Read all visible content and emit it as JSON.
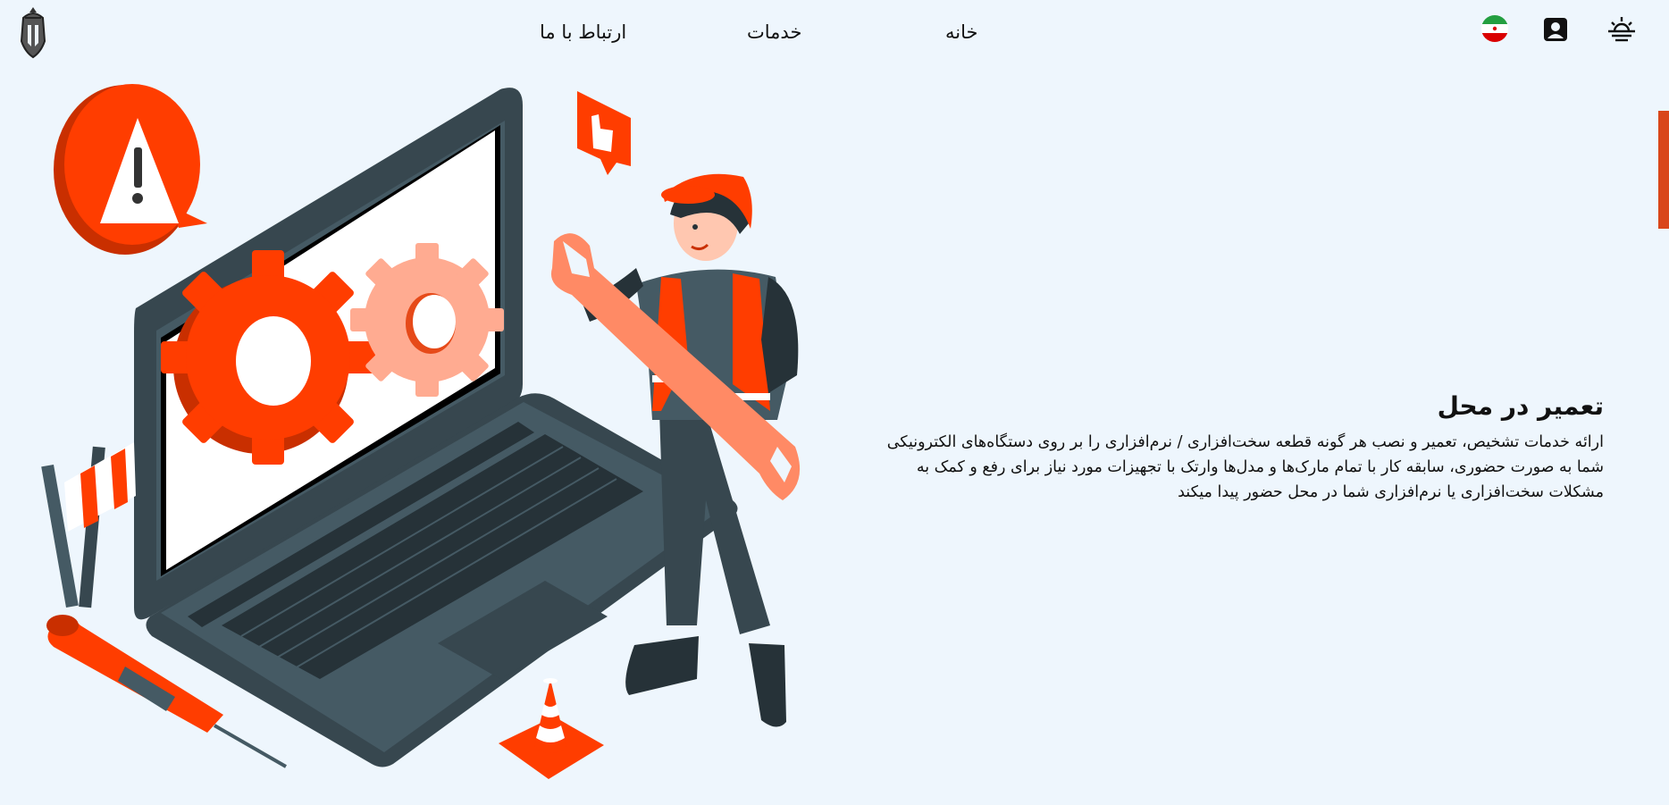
{
  "nav": {
    "contact_label": "ارتباط با ما",
    "services_label": "خدمات",
    "home_label": "خانه"
  },
  "icons": {
    "logo": "spartan-helmet-logo",
    "language": "iran-flag-icon",
    "profile": "user-profile-icon",
    "theme": "sunset-icon"
  },
  "hero": {
    "title": "تعمیر در محل",
    "description": "ارائه خدمات تشخیص، تعمیر و نصب هر گونه قطعه سخت‌افزاری / نرم‌افزاری را بر روی دستگاه‌های الکترونیکی شما به صورت حضوری، سابقه کار با تمام مارک‌ها و مدل‌ها وارتک با تجهیزات مورد نیاز برای رفع و کمک به مشکلات سخت‌افزاری یا نرم‌افزاری شما در محل حضور پیدا میکند"
  },
  "colors": {
    "accent": "#ff3d00",
    "background": "#eef6fd",
    "dark": "#455a64",
    "side_tab": "#d9461a"
  }
}
